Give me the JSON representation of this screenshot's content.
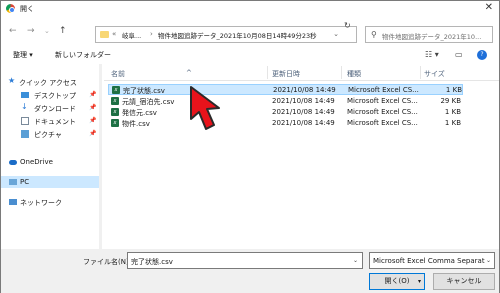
{
  "title": "開く",
  "nav": {
    "back": "←",
    "forward": "→",
    "up": "↑",
    "recent": "⌄"
  },
  "address": {
    "crumbs": [
      "«",
      "岐阜...",
      "›",
      "物件地図追跡データ_2021年10月08日14時49分23秒"
    ],
    "dropdown": "⌄",
    "refresh": "↻"
  },
  "search": {
    "placeholder": "物件地図追跡データ_2021年10..."
  },
  "toolbar": {
    "organize": "整理 ▾",
    "new_folder": "新しいフォルダー",
    "view": "☷ ▾",
    "preview": "▭",
    "help": "?"
  },
  "sidebar": {
    "items": [
      {
        "label": "クイック アクセス",
        "icon": "star-icon"
      },
      {
        "label": "デスクトップ",
        "icon": "desktop-icon",
        "pinned": true
      },
      {
        "label": "ダウンロード",
        "icon": "download-icon",
        "pinned": true
      },
      {
        "label": "ドキュメント",
        "icon": "document-icon",
        "pinned": true
      },
      {
        "label": "ピクチャ",
        "icon": "picture-icon",
        "pinned": true
      },
      {
        "label": "OneDrive",
        "icon": "cloud-icon"
      },
      {
        "label": "PC",
        "icon": "pc-icon"
      },
      {
        "label": "ネットワーク",
        "icon": "network-icon"
      }
    ],
    "pin_glyph": "📌"
  },
  "list": {
    "columns": [
      "名前",
      "更新日時",
      "種類",
      "サイズ"
    ],
    "sort_arrow": "^",
    "rows": [
      {
        "name": "完了状態.csv",
        "date": "2021/10/08 14:49",
        "type": "Microsoft Excel CS...",
        "size": "1 KB"
      },
      {
        "name": "元請_宿泊先.csv",
        "date": "2021/10/08 14:49",
        "type": "Microsoft Excel CS...",
        "size": "29 KB"
      },
      {
        "name": "発信元.csv",
        "date": "2021/10/08 14:49",
        "type": "Microsoft Excel CS...",
        "size": "1 KB"
      },
      {
        "name": "物件.csv",
        "date": "2021/10/08 14:49",
        "type": "Microsoft Excel CS...",
        "size": "1 KB"
      }
    ]
  },
  "bottom": {
    "filename_label": "ファイル名(N):",
    "filename_value": "完了状態.csv",
    "filetype": "Microsoft Excel Comma Separated",
    "open": "開く(O)",
    "cancel": "キャンセル"
  },
  "colors": {
    "selection": "#cce8ff",
    "excel": "#1d7044",
    "cursor": "#e8131b"
  }
}
